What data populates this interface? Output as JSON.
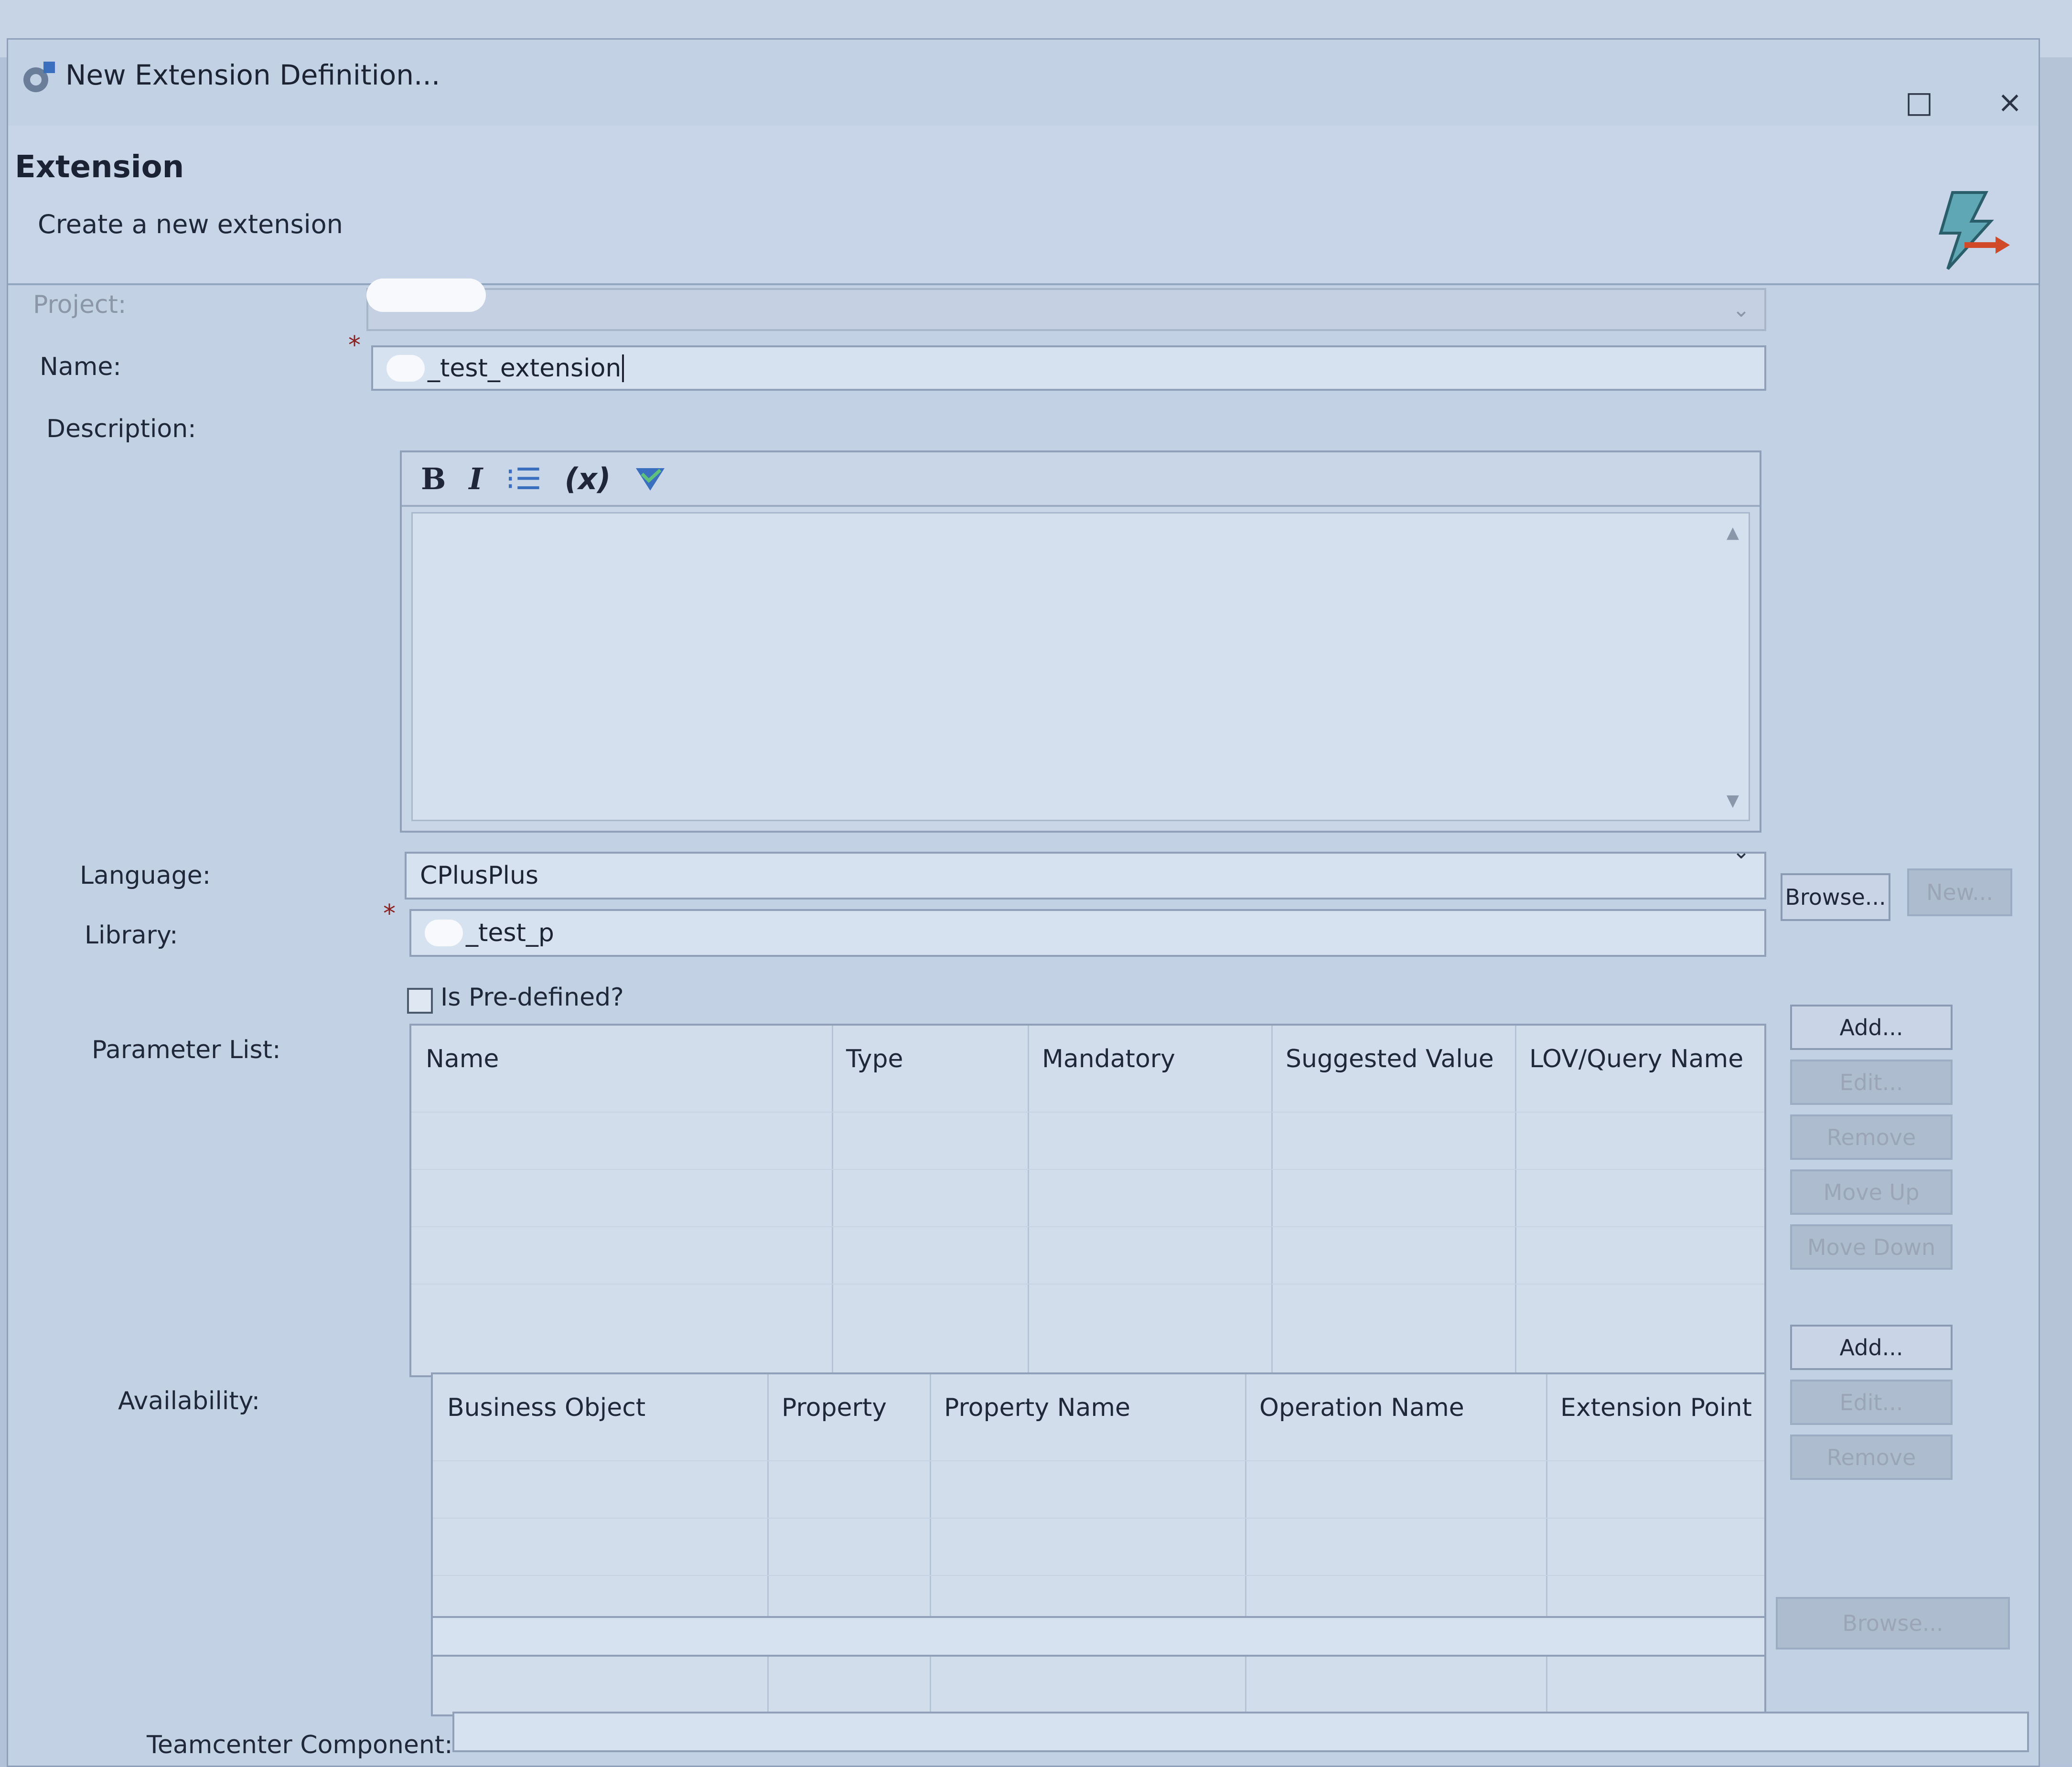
{
  "window": {
    "title": "New Extension Definition...",
    "maximize_icon": "□",
    "close_icon": "×"
  },
  "header": {
    "title": "Extension",
    "description": "Create a new extension"
  },
  "form": {
    "project_label": "Project:",
    "name_label": "Name:",
    "name_value": "_test_extension",
    "description_label": "Description:",
    "toolbar": {
      "bold": "B",
      "italic": "I",
      "list": "⁝☰",
      "variable": "(x)"
    },
    "language_label": "Language:",
    "language_value": "CPlusPlus",
    "library_label": "Library:",
    "library_value": "_test_p",
    "browse_label": "Browse...",
    "new_label": "New...",
    "predefined_label": "Is Pre-defined?",
    "required_marker": "*"
  },
  "parameter_list": {
    "label": "Parameter List:",
    "columns": [
      "Name",
      "Type",
      "Mandatory",
      "Suggested Value",
      "LOV/Query Name"
    ],
    "buttons": {
      "add": "Add...",
      "edit": "Edit...",
      "remove": "Remove",
      "move_up": "Move Up",
      "move_down": "Move Down"
    }
  },
  "availability": {
    "label": "Availability:",
    "columns": [
      "Business Object",
      "Property",
      "Property Name",
      "Operation Name",
      "Extension Point"
    ],
    "buttons": {
      "add": "Add...",
      "edit": "Edit...",
      "remove": "Remove"
    }
  },
  "teamcenter": {
    "label": "Teamcenter Component:",
    "browse_label": "Browse..."
  },
  "colors": {
    "dialog_bg": "#c3d1e4",
    "required_marker": "#8b2020",
    "icon_blue": "#3a6fbf",
    "icon_red": "#d04a2a"
  }
}
